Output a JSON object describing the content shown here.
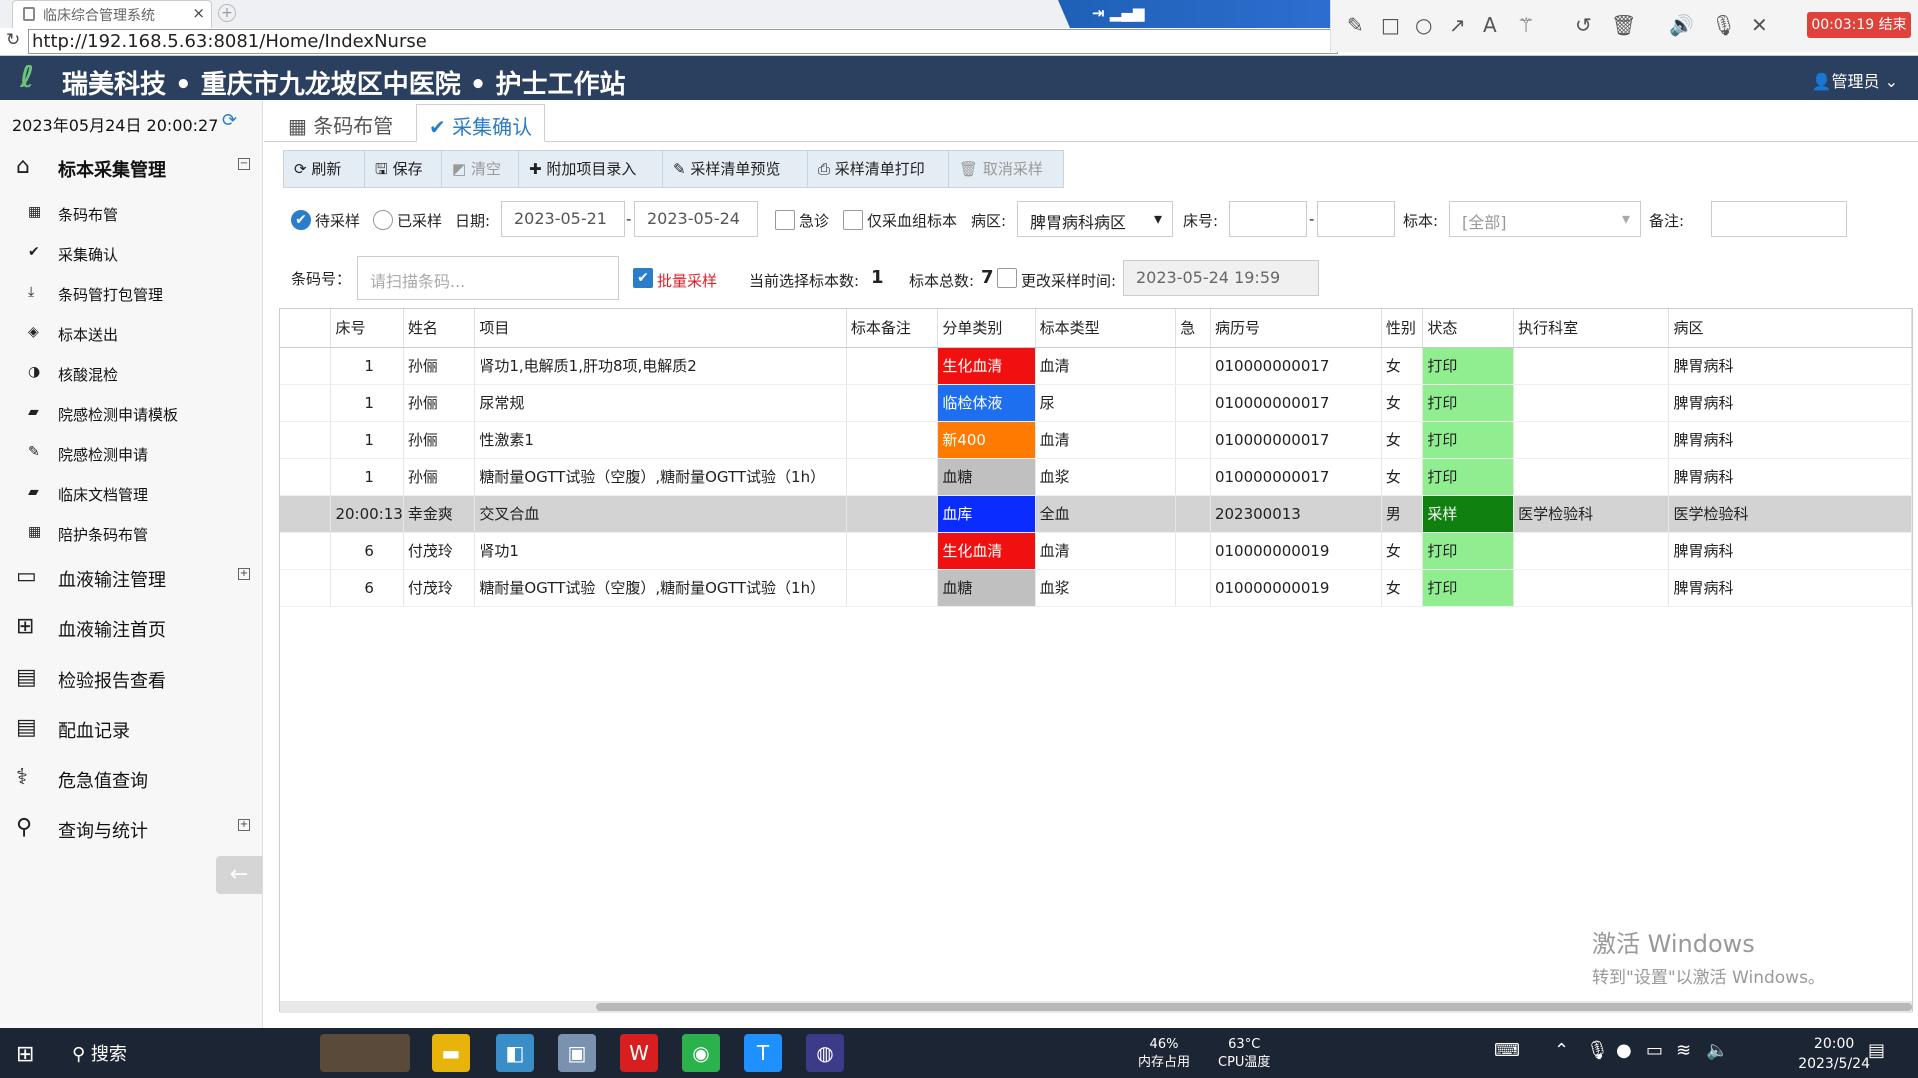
{
  "browser": {
    "tab_title": "临床综合管理系统",
    "close_glyph": "×",
    "new_tab_glyph": "+",
    "url": "http://192.168.5.63:8081/Home/IndexNurse"
  },
  "recorder": {
    "timer": "00:03:19 结束",
    "icons": [
      "pencil-icon",
      "square-icon",
      "circle-icon",
      "arrow-icon",
      "text-icon",
      "magic-wand-icon",
      "undo-icon",
      "trash-icon",
      "speaker-icon",
      "microphone-icon",
      "close-icon"
    ]
  },
  "header": {
    "title": "瑞美科技 • 重庆市九龙坡区中医院 • 护士工作站",
    "admin": "管理员"
  },
  "sidebar": {
    "datetime": "2023年05月24日 20:00:27",
    "group_specimen": "标本采集管理",
    "items": [
      {
        "label": "条码布管",
        "icon": "barcode-icon"
      },
      {
        "label": "采集确认",
        "icon": "check-icon"
      },
      {
        "label": "条码管打包管理",
        "icon": "download-icon"
      },
      {
        "label": "标本送出",
        "icon": "cube-icon"
      },
      {
        "label": "核酸混检",
        "icon": "half-circle-icon"
      },
      {
        "label": "院感检测申请模板",
        "icon": "book-icon"
      },
      {
        "label": "院感检测申请",
        "icon": "edit-icon"
      },
      {
        "label": "临床文档管理",
        "icon": "book-icon"
      },
      {
        "label": "陪护条码布管",
        "icon": "barcode-icon"
      }
    ],
    "groups": [
      {
        "label": "血液输注管理",
        "icon": "monitor-icon",
        "expandable": true
      },
      {
        "label": "血液输注首页",
        "icon": "windows-icon",
        "expandable": false
      },
      {
        "label": "检验报告查看",
        "icon": "document-icon",
        "expandable": false
      },
      {
        "label": "配血记录",
        "icon": "file-icon",
        "expandable": false
      },
      {
        "label": "危急值查询",
        "icon": "alert-icon",
        "expandable": false
      },
      {
        "label": "查询与统计",
        "icon": "search-icon",
        "expandable": true
      }
    ]
  },
  "content_tabs": [
    {
      "label": "条码布管"
    },
    {
      "label": "采集确认"
    }
  ],
  "toolbar": {
    "refresh": "刷新",
    "save": "保存",
    "clear": "清空",
    "add_item": "附加项目录入",
    "preview": "采样清单预览",
    "print": "采样清单打印",
    "cancel": "取消采样"
  },
  "filter": {
    "pending": "待采样",
    "sampled": "已采样",
    "date_label": "日期:",
    "date_from": "2023-05-21",
    "dash": "-",
    "date_to": "2023-05-24",
    "urgent": "急诊",
    "blood_only": "仅采血组标本",
    "ward_label": "病区:",
    "ward_value": "脾胃病科病区",
    "bed_label": "床号:",
    "specimen_label": "标本:",
    "specimen_value": "[全部]",
    "note_label": "备注:"
  },
  "scan": {
    "barcode_label": "条码号：",
    "barcode_placeholder": "请扫描条码...",
    "batch_label": "批量采样",
    "selected_label": "当前选择标本数:",
    "selected_count": "1",
    "total_label": "标本总数:",
    "total_count": "7",
    "change_time_label": "更改采样时间:",
    "change_time_value": "2023-05-24 19:59"
  },
  "grid": {
    "columns": [
      "床号",
      "姓名",
      "项目",
      "标本备注",
      "分单类别",
      "标本类型",
      "急",
      "病历号",
      "性别",
      "状态",
      "执行科室",
      "病区"
    ],
    "rows": [
      {
        "bed": "1",
        "name": "孙俪",
        "item": "肾功1,电解质1,肝功8项,电解质2",
        "note": "",
        "category": "生化血清",
        "cat_color": "#f01010",
        "cat_text": "#ffffff",
        "type": "血清",
        "urgent": "",
        "record": "010000000017",
        "sex": "女",
        "status": "打印",
        "status_color": "#90ee90",
        "status_text": "#222222",
        "dept": "",
        "ward": "脾胃病科",
        "selected": false
      },
      {
        "bed": "1",
        "name": "孙俪",
        "item": "尿常规",
        "note": "",
        "category": "临检体液",
        "cat_color": "#1e6ff0",
        "cat_text": "#ffffff",
        "type": "尿",
        "urgent": "",
        "record": "010000000017",
        "sex": "女",
        "status": "打印",
        "status_color": "#90ee90",
        "status_text": "#222222",
        "dept": "",
        "ward": "脾胃病科",
        "selected": false
      },
      {
        "bed": "1",
        "name": "孙俪",
        "item": "性激素1",
        "note": "",
        "category": "新400",
        "cat_color": "#ff7a00",
        "cat_text": "#ffffff",
        "type": "血清",
        "urgent": "",
        "record": "010000000017",
        "sex": "女",
        "status": "打印",
        "status_color": "#90ee90",
        "status_text": "#222222",
        "dept": "",
        "ward": "脾胃病科",
        "selected": false
      },
      {
        "bed": "1",
        "name": "孙俪",
        "item": "糖耐量OGTT试验（空腹）,糖耐量OGTT试验（1h）",
        "note": "",
        "category": "血糖",
        "cat_color": "#c0c0c0",
        "cat_text": "#222222",
        "type": "血浆",
        "urgent": "",
        "record": "010000000017",
        "sex": "女",
        "status": "打印",
        "status_color": "#90ee90",
        "status_text": "#222222",
        "dept": "",
        "ward": "脾胃病科",
        "selected": false
      },
      {
        "bed": "20:00:13",
        "name": "幸金爽",
        "item": "交叉合血",
        "note": "",
        "category": "血库",
        "cat_color": "#0a2cff",
        "cat_text": "#ffffff",
        "type": "全血",
        "urgent": "",
        "record": "202300013",
        "sex": "男",
        "status": "采样",
        "status_color": "#108010",
        "status_text": "#ffffff",
        "dept": "医学检验科",
        "ward": "医学检验科",
        "selected": true
      },
      {
        "bed": "6",
        "name": "付茂玲",
        "item": "肾功1",
        "note": "",
        "category": "生化血清",
        "cat_color": "#f01010",
        "cat_text": "#ffffff",
        "type": "血清",
        "urgent": "",
        "record": "010000000019",
        "sex": "女",
        "status": "打印",
        "status_color": "#90ee90",
        "status_text": "#222222",
        "dept": "",
        "ward": "脾胃病科",
        "selected": false
      },
      {
        "bed": "6",
        "name": "付茂玲",
        "item": "糖耐量OGTT试验（空腹）,糖耐量OGTT试验（1h）",
        "note": "",
        "category": "血糖",
        "cat_color": "#c0c0c0",
        "cat_text": "#222222",
        "type": "血浆",
        "urgent": "",
        "record": "010000000019",
        "sex": "女",
        "status": "打印",
        "status_color": "#90ee90",
        "status_text": "#222222",
        "dept": "",
        "ward": "脾胃病科",
        "selected": false
      }
    ]
  },
  "watermark": {
    "line1": "激活 Windows",
    "line2": "转到\"设置\"以激活 Windows。"
  },
  "taskbar": {
    "search": "搜索",
    "mem_value": "46%",
    "mem_label": "内存占用",
    "cpu_value": "63°C",
    "cpu_label": "CPU温度",
    "time": "20:00",
    "date": "2023/5/24"
  }
}
